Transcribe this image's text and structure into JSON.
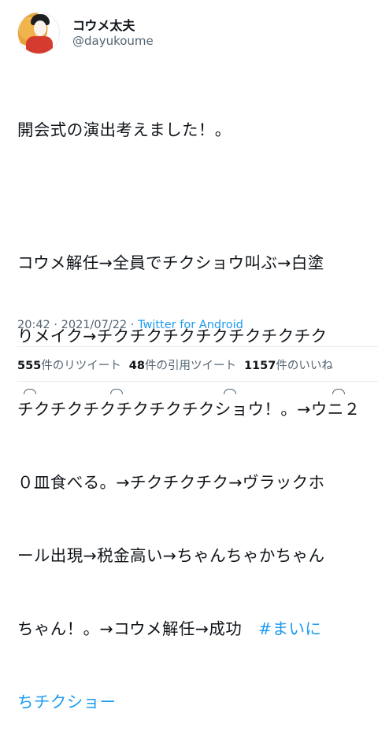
{
  "user": {
    "display_name": "コウメ太夫",
    "handle": "@dayukoume"
  },
  "tweet": {
    "lines": [
      "開会式の演出考えました！。",
      "コウメ解任→全員でチクショウ叫ぶ→白塗",
      "りメイク→チクチクチクチクチクチクチク",
      "チクチクチクチクチクチクショウ！。→ウニ２",
      "０皿食べる。→チクチクチク→ヴラックホ",
      "ール出現→税金高い→ちゃんちゃかちゃん",
      "ちゃん！。→コウメ解任→成功　"
    ],
    "hashtag_part1": "#まいに",
    "hashtag_part2": "ちチクショー"
  },
  "meta": {
    "time": "20:42",
    "date": "2021/07/22",
    "separator": " · ",
    "source": "Twitter for Android"
  },
  "stats": {
    "retweets_count": "555",
    "retweets_label": "件のリツイート",
    "quotes_count": "48",
    "quotes_label": "件の引用ツイート",
    "likes_count": "1157",
    "likes_label": "件のいいね"
  },
  "colors": {
    "accent": "#1d9bf0",
    "text": "#0f1419",
    "muted": "#536471"
  }
}
